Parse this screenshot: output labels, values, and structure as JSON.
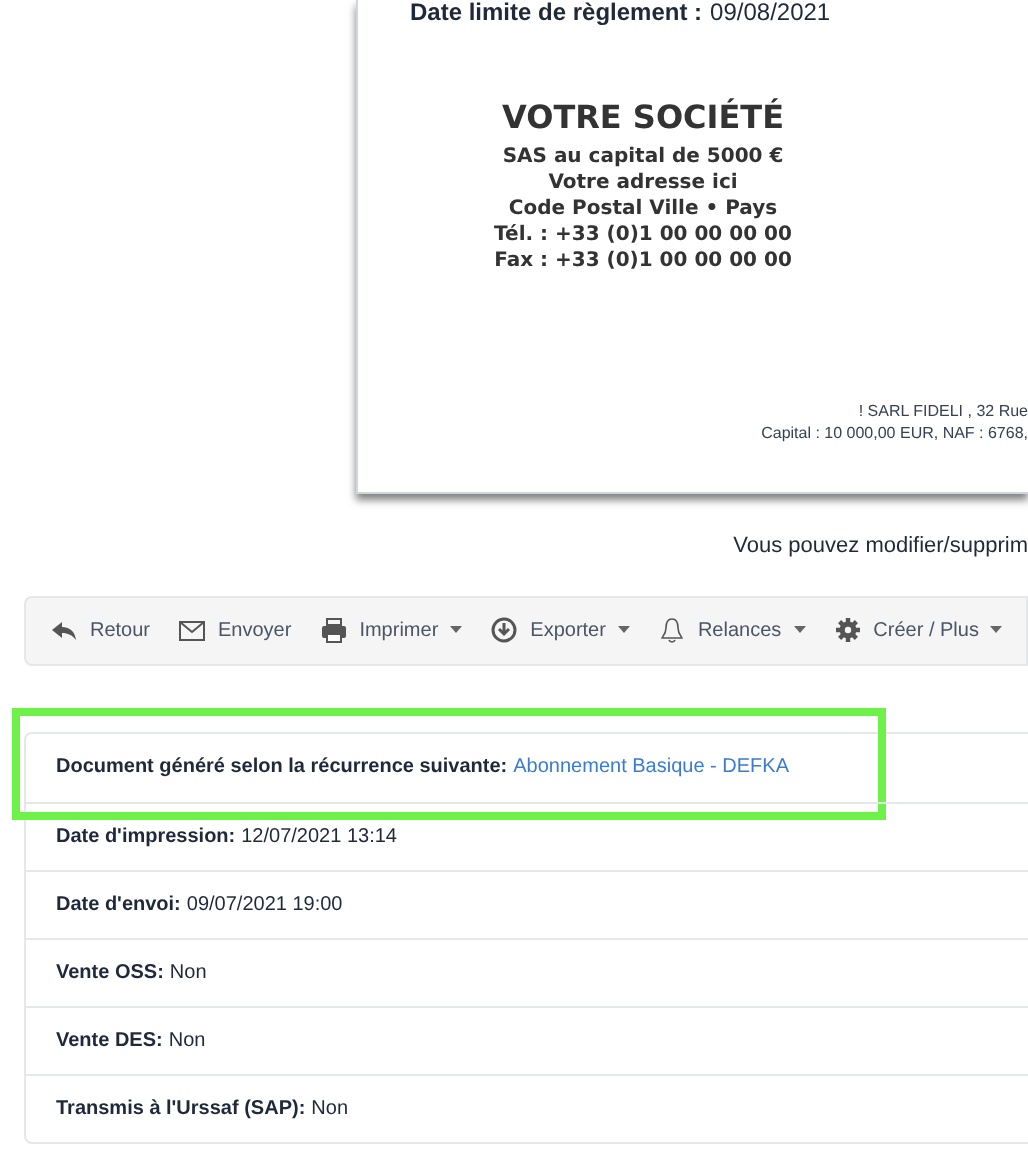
{
  "document": {
    "due_date_label": "Date limite de règlement :",
    "due_date": "09/08/2021",
    "company": [
      "VOTRE SOCIÉTÉ",
      "SAS au capital de 5000 €",
      "Votre adresse ici",
      "Code Postal Ville • Pays",
      "Tél. : +33 (0)1 00 00 00 00",
      "Fax : +33 (0)1 00 00 00 00"
    ],
    "footer": [
      "! SARL FIDELI , 32 Rue",
      "Capital : 10 000,00 EUR, NAF : 6768,"
    ]
  },
  "notice": "Vous pouvez modifier/supprim",
  "toolbar": [
    {
      "kind": "reply",
      "label": "Retour",
      "dropdown": false
    },
    {
      "kind": "mail",
      "label": "Envoyer",
      "dropdown": false
    },
    {
      "kind": "print",
      "label": "Imprimer",
      "dropdown": true
    },
    {
      "kind": "download",
      "label": "Exporter",
      "dropdown": true
    },
    {
      "kind": "bell",
      "label": "Relances",
      "dropdown": true
    },
    {
      "kind": "gear",
      "label": "Créer / Plus",
      "dropdown": true
    }
  ],
  "details": [
    {
      "label": "Document généré selon la récurrence suivante:",
      "value": "Abonnement Basique - DEFKA",
      "kind": "link",
      "highlighted": true
    },
    {
      "label": "Date d'impression:",
      "value": "12/07/2021 13:14",
      "kind": "text",
      "highlighted": false
    },
    {
      "label": "Date d'envoi:",
      "value": "09/07/2021 19:00",
      "kind": "text",
      "highlighted": false
    },
    {
      "label": "Vente OSS:",
      "value": "Non",
      "kind": "text",
      "highlighted": false
    },
    {
      "label": "Vente DES:",
      "value": "Non",
      "kind": "text",
      "highlighted": false
    },
    {
      "label": "Transmis à l'Urssaf (SAP):",
      "value": "Non",
      "kind": "text",
      "highlighted": false
    }
  ]
}
